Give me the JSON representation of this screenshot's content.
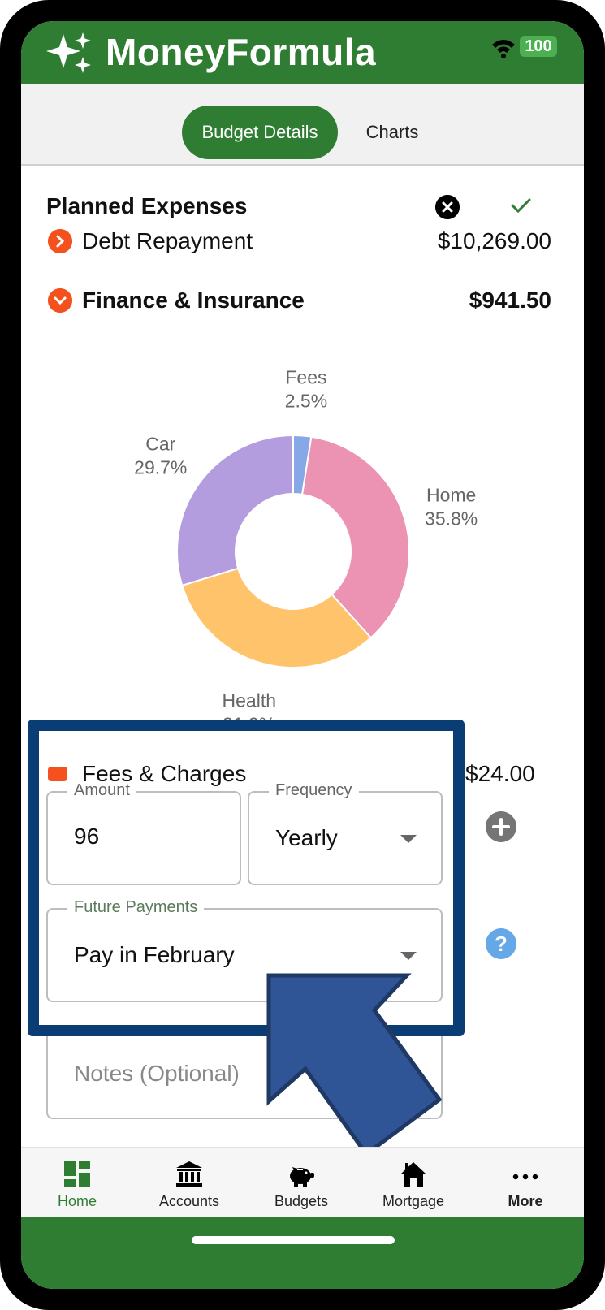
{
  "app": {
    "title": "MoneyFormula",
    "battery": "100"
  },
  "tabs": [
    {
      "label": "Budget Details",
      "active": true
    },
    {
      "label": "Charts",
      "active": false
    }
  ],
  "section": {
    "title": "Planned Expenses"
  },
  "categories": [
    {
      "name": "Debt Repayment",
      "amount": "$10,269.00",
      "expanded": false
    },
    {
      "name": "Finance & Insurance",
      "amount": "$941.50",
      "expanded": true
    }
  ],
  "chart_data": {
    "type": "pie",
    "donut": true,
    "slices": [
      {
        "label": "Fees",
        "percent_label": "2.5%",
        "value": 2.5,
        "color": "#86a8e7"
      },
      {
        "label": "Home",
        "percent_label": "35.8%",
        "value": 35.8,
        "color": "#ec92b2"
      },
      {
        "label": "Health",
        "percent_label": "31.9%",
        "value": 31.9,
        "color": "#ffc36b"
      },
      {
        "label": "Car",
        "percent_label": "29.7%",
        "value": 29.7,
        "color": "#b39ddf"
      }
    ]
  },
  "subcategory": {
    "name": "Fees & Charges",
    "amount": "$24.00",
    "color": "#f4511e"
  },
  "form": {
    "amount_label": "Amount",
    "amount_value": "96",
    "frequency_label": "Frequency",
    "frequency_value": "Yearly",
    "future_label": "Future Payments",
    "future_value": "Pay in February",
    "notes_placeholder": "Notes (Optional)"
  },
  "nav": [
    {
      "label": "Home",
      "icon": "grid-icon",
      "active": true
    },
    {
      "label": "Accounts",
      "icon": "bank-icon",
      "active": false
    },
    {
      "label": "Budgets",
      "icon": "piggy-bank-icon",
      "active": false
    },
    {
      "label": "Mortgage",
      "icon": "house-icon",
      "active": false
    },
    {
      "label": "More",
      "icon": "more-dots-icon",
      "active": false
    }
  ],
  "colors": {
    "brand": "#2e7d32",
    "accent": "#f4511e",
    "highlight": "#0a3d73"
  }
}
